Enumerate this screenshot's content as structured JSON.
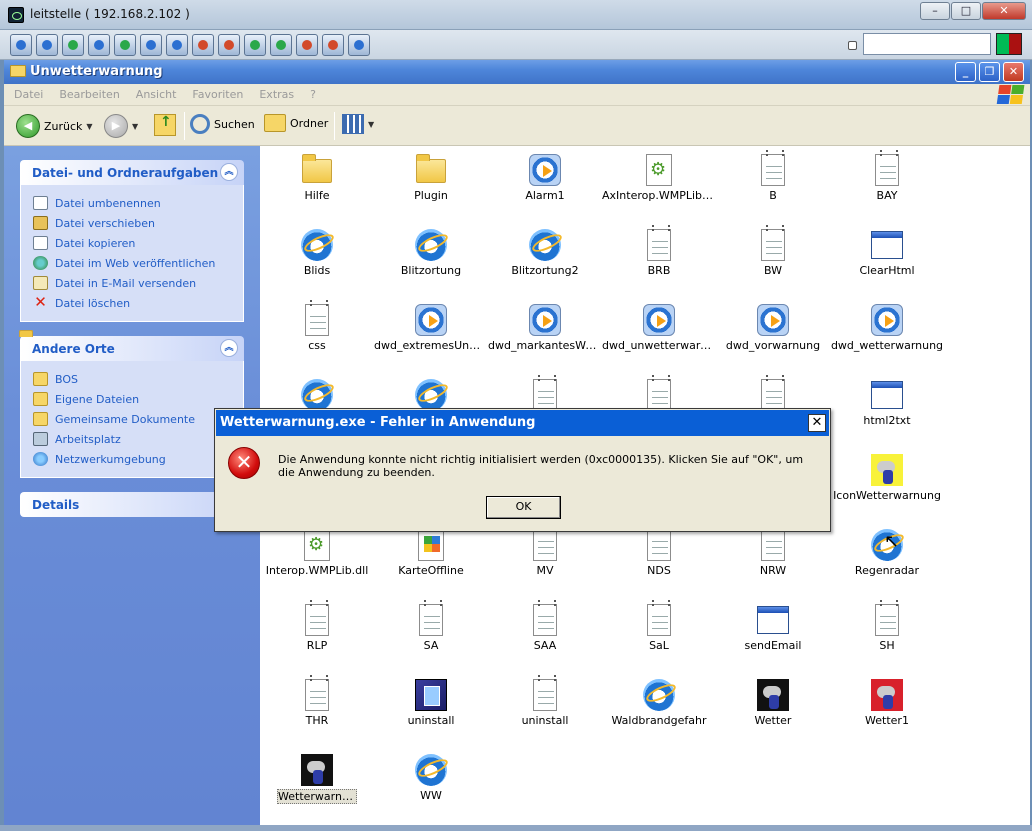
{
  "remote_window": {
    "title": "leitstelle ( 192.168.2.102 )",
    "buttons": [
      "–",
      "□",
      "✕"
    ],
    "search_value": ""
  },
  "explorer": {
    "title": "Unwetterwarnung",
    "window_buttons": [
      "_",
      "❐",
      "✕"
    ],
    "menu": [
      "Datei",
      "Bearbeiten",
      "Ansicht",
      "Favoriten",
      "Extras",
      "?"
    ],
    "toolbar": {
      "back": "Zurück",
      "search": "Suchen",
      "folders": "Ordner"
    }
  },
  "taskpane": {
    "file_tasks": {
      "heading": "Datei- und Ordneraufgaben",
      "links": [
        {
          "label": "Datei umbenennen",
          "icon": "rename-icon"
        },
        {
          "label": "Datei verschieben",
          "icon": "move-icon"
        },
        {
          "label": "Datei kopieren",
          "icon": "copy-icon"
        },
        {
          "label": "Datei im Web veröffentlichen",
          "icon": "web-publish-icon"
        },
        {
          "label": "Datei in E-Mail versenden",
          "icon": "email-icon"
        },
        {
          "label": "Datei löschen",
          "icon": "delete-icon"
        }
      ]
    },
    "other_places": {
      "heading": "Andere Orte",
      "links": [
        {
          "label": "BOS",
          "icon": "folder-icon"
        },
        {
          "label": "Eigene Dateien",
          "icon": "folder-icon"
        },
        {
          "label": "Gemeinsame Dokumente",
          "icon": "folder-icon"
        },
        {
          "label": "Arbeitsplatz",
          "icon": "computer-icon"
        },
        {
          "label": "Netzwerkumgebung",
          "icon": "network-icon"
        }
      ]
    },
    "details": {
      "heading": "Details"
    }
  },
  "files": [
    {
      "name": "Hilfe",
      "type": "folder"
    },
    {
      "name": "Plugin",
      "type": "folder"
    },
    {
      "name": "Alarm1",
      "type": "media"
    },
    {
      "name": "AxInterop.WMPLib.dll",
      "type": "dll"
    },
    {
      "name": "B",
      "type": "doc"
    },
    {
      "name": "BAY",
      "type": "doc"
    },
    {
      "name": "Blids",
      "type": "ie"
    },
    {
      "name": "Blitzortung",
      "type": "ie"
    },
    {
      "name": "Blitzortung2",
      "type": "ie"
    },
    {
      "name": "BRB",
      "type": "doc"
    },
    {
      "name": "BW",
      "type": "doc"
    },
    {
      "name": "ClearHtml",
      "type": "win"
    },
    {
      "name": "css",
      "type": "doc"
    },
    {
      "name": "dwd_extremesUnw…",
      "type": "media"
    },
    {
      "name": "dwd_markantesWetter",
      "type": "media"
    },
    {
      "name": "dwd_unwetterwarn…",
      "type": "media"
    },
    {
      "name": "dwd_vorwarnung",
      "type": "media"
    },
    {
      "name": "dwd_wetterwarnung",
      "type": "media"
    },
    {
      "name": "",
      "type": "ie"
    },
    {
      "name": "",
      "type": "ie"
    },
    {
      "name": "",
      "type": "doc"
    },
    {
      "name": "",
      "type": "doc"
    },
    {
      "name": "",
      "type": "doc"
    },
    {
      "name": "html2txt",
      "type": "win"
    },
    {
      "name": "",
      "type": "none"
    },
    {
      "name": "",
      "type": "none"
    },
    {
      "name": "",
      "type": "none"
    },
    {
      "name": "",
      "type": "none"
    },
    {
      "name": "",
      "type": "none"
    },
    {
      "name": "IconWetterwarnung",
      "type": "weather-yellow"
    },
    {
      "name": "Interop.WMPLib.dll",
      "type": "dll"
    },
    {
      "name": "KarteOffline",
      "type": "karte"
    },
    {
      "name": "MV",
      "type": "doc"
    },
    {
      "name": "NDS",
      "type": "doc"
    },
    {
      "name": "NRW",
      "type": "doc"
    },
    {
      "name": "Regenradar",
      "type": "ie"
    },
    {
      "name": "RLP",
      "type": "doc"
    },
    {
      "name": "SA",
      "type": "doc"
    },
    {
      "name": "SAA",
      "type": "doc"
    },
    {
      "name": "SaL",
      "type": "doc"
    },
    {
      "name": "sendEmail",
      "type": "win"
    },
    {
      "name": "SH",
      "type": "doc"
    },
    {
      "name": "THR",
      "type": "doc"
    },
    {
      "name": "uninstall",
      "type": "uninst"
    },
    {
      "name": "uninstall",
      "type": "doc"
    },
    {
      "name": "Waldbrandgefahr",
      "type": "ie"
    },
    {
      "name": "Wetter",
      "type": "weather"
    },
    {
      "name": "Wetter1",
      "type": "weather-red"
    },
    {
      "name": "Wetterwarnung",
      "type": "weather",
      "selected": true
    },
    {
      "name": "WW",
      "type": "ie"
    }
  ],
  "dialog": {
    "title": "Wetterwarnung.exe - Fehler in Anwendung",
    "close_glyph": "✕",
    "icon": "error-icon",
    "message": "Die Anwendung konnte nicht richtig initialisiert werden (0xc0000135). Klicken Sie auf \"OK\", um die Anwendung zu beenden.",
    "ok_label": "OK"
  }
}
